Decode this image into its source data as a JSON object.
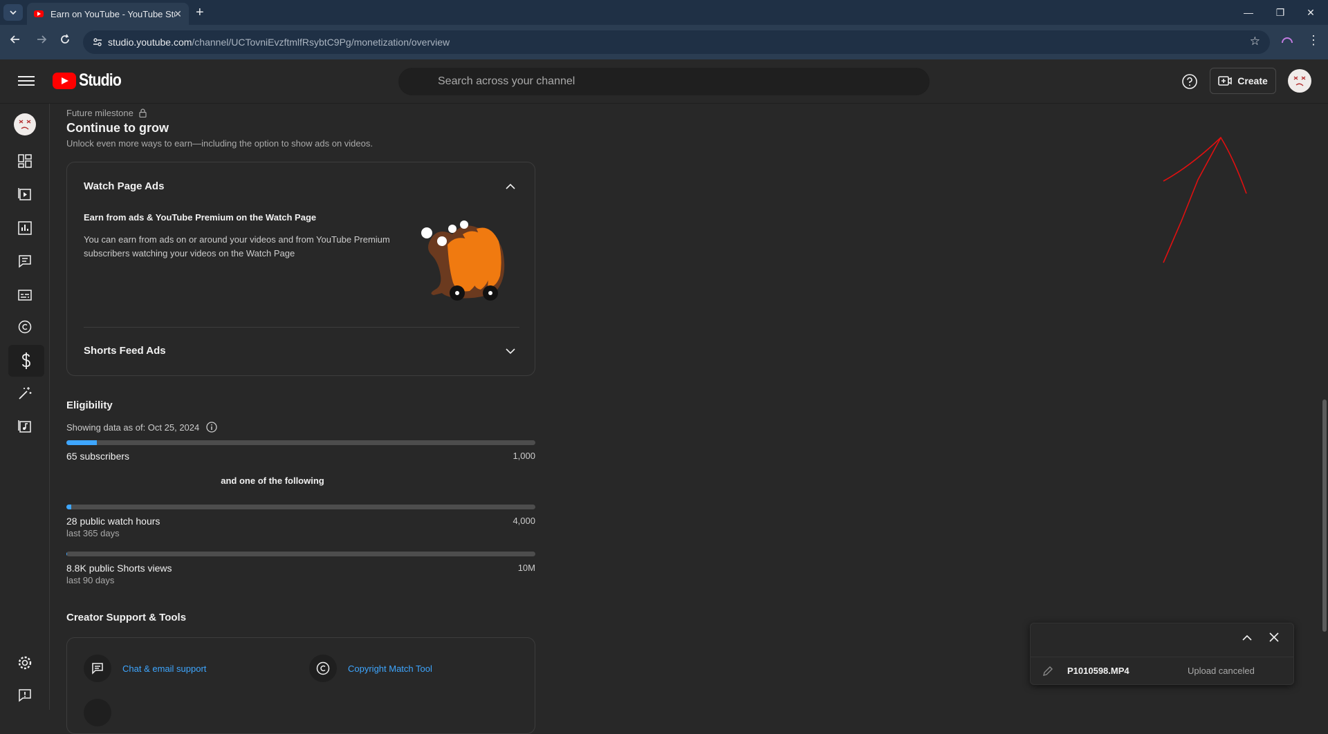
{
  "browser": {
    "tab_title": "Earn on YouTube - YouTube Studio",
    "tab_close": "✕",
    "new_tab": "+",
    "url_host": "studio.youtube.com",
    "url_path": "/channel/UCTovniEvzftmlfRsybtC9Pg/monetization/overview",
    "minimize": "—",
    "restore": "❐",
    "close": "✕"
  },
  "header": {
    "logo_text": "Studio",
    "search_placeholder": "Search across your channel",
    "create_label": "Create"
  },
  "milestone": {
    "eyebrow": "Future milestone",
    "title": "Continue to grow",
    "description": "Unlock even more ways to earn—including the option to show ads on videos."
  },
  "ads_card": {
    "watch_page": {
      "title": "Watch Page Ads",
      "subtitle": "Earn from ads & YouTube Premium on the Watch Page",
      "body": "You can earn from ads on or around your videos and from YouTube Premium subscribers watching your videos on the Watch Page"
    },
    "shorts": {
      "title": "Shorts Feed Ads"
    }
  },
  "eligibility": {
    "title": "Eligibility",
    "as_of": "Showing data as of: Oct 25, 2024",
    "subscribers": {
      "label": "65 subscribers",
      "goal": "1,000",
      "progress": 0.065
    },
    "separator": "and one of the following",
    "watch_hours": {
      "label": "28 public watch hours",
      "sub": "last 365 days",
      "goal": "4,000",
      "progress": 0.007
    },
    "shorts_views": {
      "label": "8.8K public Shorts views",
      "sub": "last 90 days",
      "goal": "10M",
      "progress": 0.0009
    }
  },
  "support": {
    "title": "Creator Support & Tools",
    "items": [
      {
        "label": "Chat & email support",
        "icon": "chat-icon"
      },
      {
        "label": "Copyright Match Tool",
        "icon": "copyright-icon"
      }
    ]
  },
  "upload": {
    "filename": "P1010598.MP4",
    "status": "Upload canceled"
  },
  "colors": {
    "accent": "#3ea6ff",
    "brand": "#ff0000",
    "annotation": "#e01010"
  }
}
